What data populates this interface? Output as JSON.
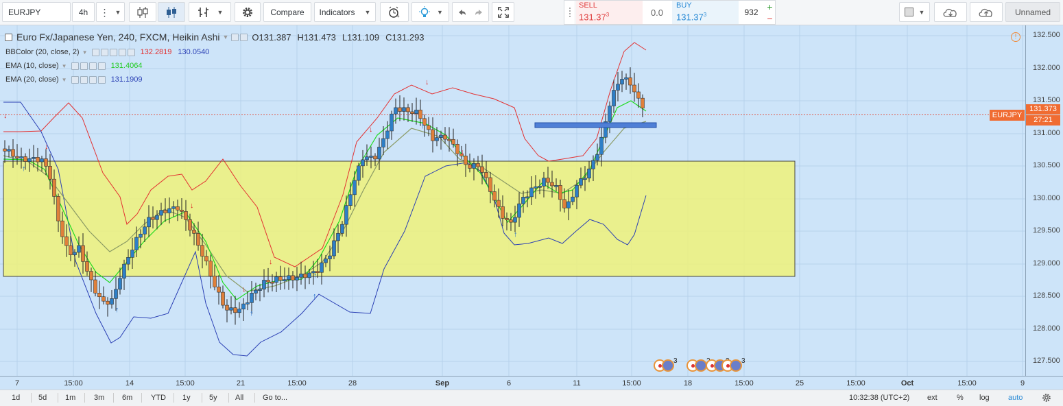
{
  "toolbar": {
    "symbol": "EURJPY",
    "interval": "4h",
    "compare_label": "Compare",
    "indicators_label": "Indicators"
  },
  "trade": {
    "sell_label": "SELL",
    "sell_price": "131.37",
    "sell_sup": "3",
    "spread": "0.0",
    "buy_label": "BUY",
    "buy_price": "131.37",
    "buy_sup": "3",
    "quantity": "932",
    "plus": "+",
    "minus": "−"
  },
  "layout_name": "Unnamed",
  "legend": {
    "title": "Euro Fx/Japanese Yen, 240, FXCM, Heikin Ashi",
    "ohlc": {
      "o": "O131.387",
      "h": "H131.473",
      "l": "L131.109",
      "c": "C131.293"
    },
    "bb": {
      "name": "BBColor (20, close, 2)",
      "upper": "132.2819",
      "lower": "130.0540"
    },
    "ema10": {
      "name": "EMA (10, close)",
      "value": "131.4064"
    },
    "ema20": {
      "name": "EMA (20, close)",
      "value": "131.1909"
    }
  },
  "price_axis": {
    "ticks": [
      "132.500",
      "132.000",
      "131.500",
      "131.000",
      "130.500",
      "130.000",
      "129.500",
      "129.000",
      "128.500",
      "128.000",
      "127.500"
    ],
    "symbol_tag": "EURJPY",
    "current_price": "131.373",
    "countdown": "27:21",
    "colors": {
      "price_tag": "#f06c32"
    }
  },
  "time_axis": {
    "ticks": [
      "7",
      "15:00",
      "14",
      "15:00",
      "21",
      "15:00",
      "28",
      "Sep",
      "6",
      "11",
      "15:00",
      "18",
      "15:00",
      "25",
      "15:00",
      "Oct",
      "15:00",
      "9"
    ]
  },
  "events": [
    {
      "count": "3"
    },
    {
      "count": "2"
    },
    {
      "count": "2"
    },
    {
      "count": "3"
    }
  ],
  "bottom": {
    "ranges": [
      "1d",
      "5d",
      "1m",
      "3m",
      "6m",
      "YTD",
      "1y",
      "5y",
      "All"
    ],
    "goto": "Go to...",
    "clock": "10:32:38 (UTC+2)",
    "ext": "ext",
    "pct": "%",
    "log": "log",
    "auto": "auto"
  },
  "colors": {
    "background": "#cde4f9",
    "zone": "#f2f56a",
    "bb_upper": "#e33131",
    "bb_lower": "#2a3fb4",
    "ema10": "#1fdb1f",
    "ema20": "#8a9a64",
    "up_candle": "#2e7fc7",
    "down_candle": "#e0803a"
  }
}
